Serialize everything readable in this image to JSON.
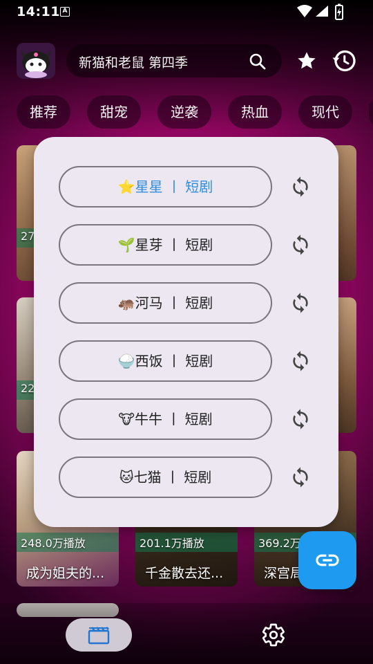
{
  "status_bar": {
    "time": "14:11",
    "a_label": "A"
  },
  "header": {
    "search_text": "新猫和老鼠 第四季"
  },
  "tabs": [
    "推荐",
    "甜宠",
    "逆袭",
    "热血",
    "现代"
  ],
  "cards_visible": [
    {
      "count": "27",
      "title": ""
    },
    {
      "count": "22",
      "title": ""
    },
    {
      "count": "248.0万播放",
      "title": "成为姐夫的..."
    },
    {
      "count": "201.1万播放",
      "title": "千金散去还..."
    },
    {
      "count": "369.2万",
      "title": "深宫局"
    }
  ],
  "source_modal": {
    "sources": [
      {
        "emoji": "⭐",
        "label": "星星 丨 短剧",
        "active": true
      },
      {
        "emoji": "🌱",
        "label": "星芽 丨 短剧",
        "active": false
      },
      {
        "emoji": "🦛",
        "label": "河马 丨 短剧",
        "active": false
      },
      {
        "emoji": "🍚",
        "label": "西饭 丨 短剧",
        "active": false
      },
      {
        "emoji": "🐮",
        "label": "牛牛 丨 短剧",
        "active": false
      },
      {
        "emoji": "🐱",
        "label": "七猫 丨 短剧",
        "active": false
      }
    ],
    "refresh_icon": "refresh-icon"
  },
  "fab": {
    "icon": "link-icon",
    "color": "#1e9bf0"
  },
  "bottom_nav": {
    "items": [
      {
        "icon": "video-icon",
        "active": true
      },
      {
        "icon": "gear-icon",
        "active": false
      }
    ]
  },
  "colors": {
    "accent": "#2e8ee0",
    "background": "#d0108a",
    "modal": "#ece7f0"
  }
}
